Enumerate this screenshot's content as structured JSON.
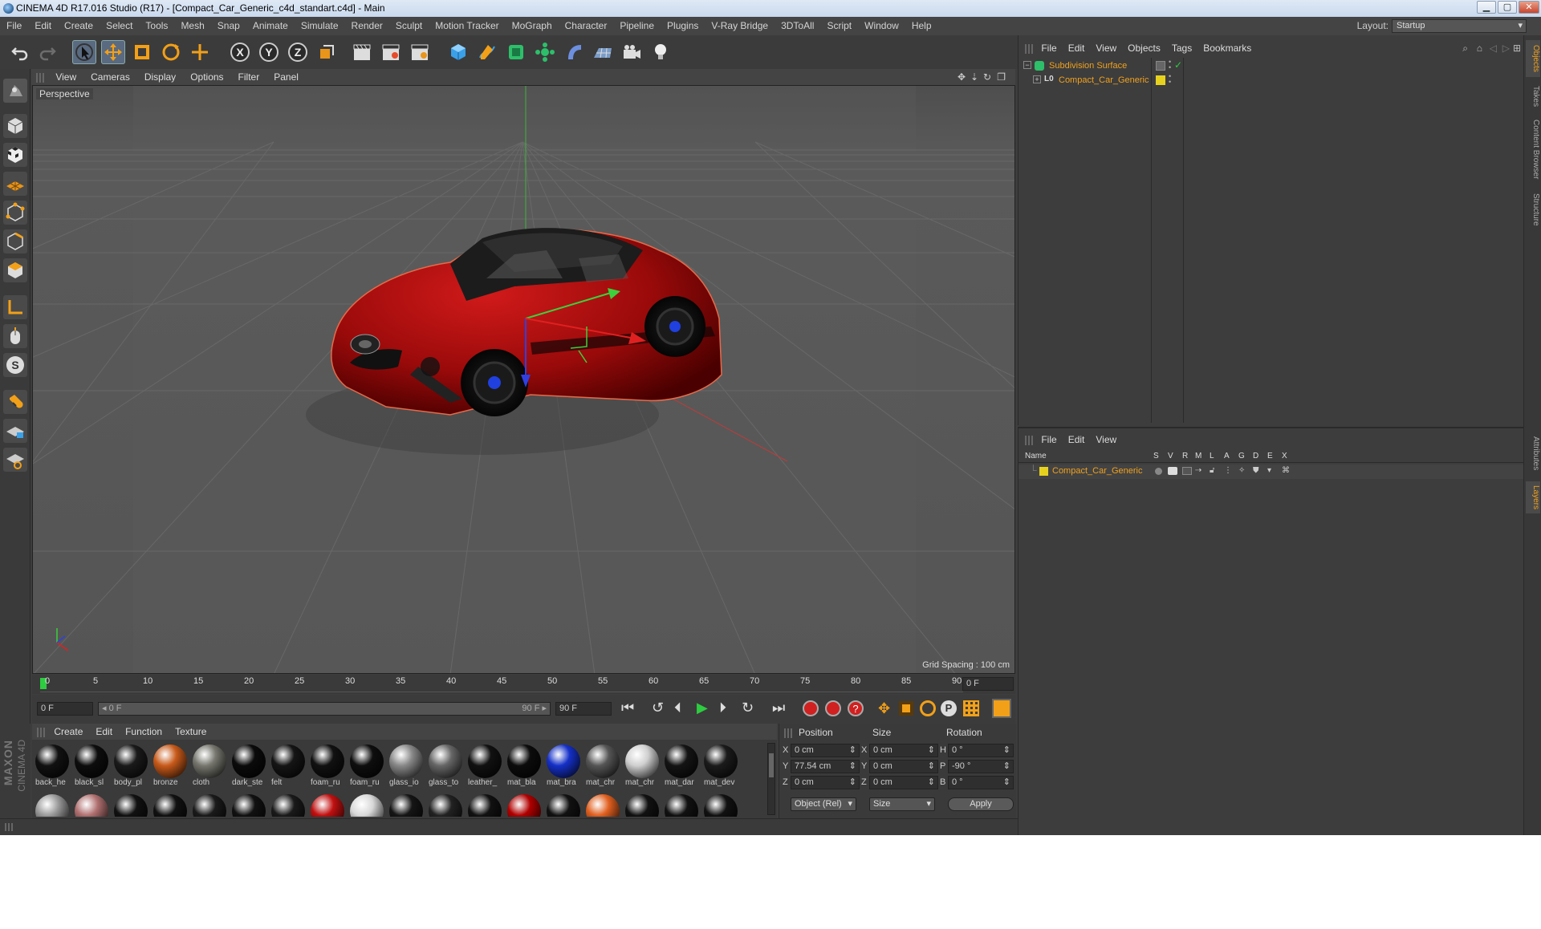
{
  "window": {
    "title": "CINEMA 4D R17.016 Studio (R17) - [Compact_Car_Generic_c4d_standart.c4d] - Main",
    "min": "▁",
    "max": "▢",
    "close": "✕"
  },
  "menubar": {
    "items": [
      "File",
      "Edit",
      "Create",
      "Select",
      "Tools",
      "Mesh",
      "Snap",
      "Animate",
      "Simulate",
      "Render",
      "Sculpt",
      "Motion Tracker",
      "MoGraph",
      "Character",
      "Pipeline",
      "Plugins",
      "V-Ray Bridge",
      "3DToAll",
      "Script",
      "Window",
      "Help"
    ],
    "layout_label": "Layout:",
    "layout_value": "Startup"
  },
  "viewport": {
    "menu": [
      "View",
      "Cameras",
      "Display",
      "Options",
      "Filter",
      "Panel"
    ],
    "camera": "Perspective",
    "grid_spacing": "Grid Spacing : 100 cm"
  },
  "timeline": {
    "ticks": [
      "0",
      "5",
      "10",
      "15",
      "20",
      "25",
      "30",
      "35",
      "40",
      "45",
      "50",
      "55",
      "60",
      "65",
      "70",
      "75",
      "80",
      "85",
      "90"
    ],
    "current_frame": "0 F",
    "start_field": "0 F",
    "range_start": "◂ 0 F",
    "range_end": "90 F ▸",
    "end_field": "90 F",
    "end_frame_right": "0 F"
  },
  "materials": {
    "menu": [
      "Create",
      "Edit",
      "Function",
      "Texture"
    ],
    "row1": [
      {
        "name": "back_he",
        "color": "#111"
      },
      {
        "name": "black_sl",
        "color": "#0d0d0d"
      },
      {
        "name": "body_pl",
        "color": "#1a1a1a"
      },
      {
        "name": "bronze",
        "color": "#c85a1a"
      },
      {
        "name": "cloth",
        "color": "#77776f"
      },
      {
        "name": "dark_ste",
        "color": "#0b0b0b"
      },
      {
        "name": "felt",
        "color": "#151515"
      },
      {
        "name": "foam_ru",
        "color": "#111"
      },
      {
        "name": "foam_ru",
        "color": "#0e0e0e"
      },
      {
        "name": "glass_io",
        "color": "#888"
      },
      {
        "name": "glass_to",
        "color": "#666"
      },
      {
        "name": "leather_",
        "color": "#111"
      },
      {
        "name": "mat_bla",
        "color": "#0c0c0c"
      },
      {
        "name": "mat_bra",
        "color": "#1530c8"
      },
      {
        "name": "mat_chr",
        "color": "#555"
      },
      {
        "name": "mat_chr",
        "color": "#cfcfcf"
      },
      {
        "name": "mat_dar",
        "color": "#141414"
      },
      {
        "name": "mat_dev",
        "color": "#1b1b1b"
      }
    ],
    "row2_colors": [
      "#9a9a9a",
      "#b07070",
      "#111",
      "#111",
      "#1a1a1a",
      "#111",
      "#1a1a1a",
      "#c01010",
      "#d8d8d8",
      "#151515",
      "#222",
      "#111",
      "#b00000",
      "#111",
      "#e06020",
      "#111",
      "#111",
      "#111"
    ],
    "brand_maxon": "MAXON",
    "brand_c4d": "CINEMA 4D"
  },
  "coords": {
    "headers": [
      "Position",
      "Size",
      "Rotation"
    ],
    "rows": [
      {
        "axis": "X",
        "pos": "0 cm",
        "saxis": "X",
        "size": "0 cm",
        "raxis": "H",
        "rot": "0 °"
      },
      {
        "axis": "Y",
        "pos": "77.54 cm",
        "saxis": "Y",
        "size": "0 cm",
        "raxis": "P",
        "rot": "-90 °"
      },
      {
        "axis": "Z",
        "pos": "0 cm",
        "saxis": "Z",
        "size": "0 cm",
        "raxis": "B",
        "rot": "0 °"
      }
    ],
    "mode": "Object (Rel)",
    "size_mode": "Size",
    "apply": "Apply"
  },
  "object_manager": {
    "menu": [
      "File",
      "Edit",
      "View",
      "Objects",
      "Tags",
      "Bookmarks"
    ],
    "objects": [
      {
        "name": "Subdivision Surface",
        "level": 0
      },
      {
        "name": "Compact_Car_Generic",
        "level": 1
      }
    ]
  },
  "layer_manager": {
    "menu": [
      "File",
      "Edit",
      "View"
    ],
    "columns": [
      "Name",
      "S",
      "V",
      "R",
      "M",
      "L",
      "A",
      "G",
      "D",
      "E",
      "X"
    ],
    "layers": [
      {
        "name": "Compact_Car_Generic",
        "color": "#e6d21e"
      }
    ]
  },
  "right_tabs": [
    "Objects",
    "Takes",
    "Content Browser",
    "Structure",
    "Attributes",
    "Layers"
  ],
  "colors": {
    "accent": "#f0a11e",
    "layer_yellow": "#e6d21e",
    "car_red": "#a50d0d"
  }
}
